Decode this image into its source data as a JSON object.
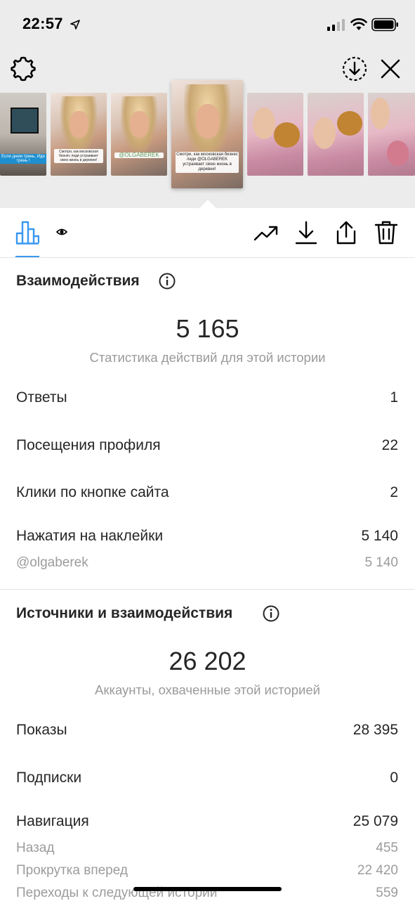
{
  "status_bar": {
    "time": "22:57"
  },
  "thumbnails": [
    {
      "kind": "tv",
      "caption": "Если днем трень, Иди трень !"
    },
    {
      "kind": "woman",
      "caption": "Смотри, как московская бизнес леди устраивает свою жизнь в деревне!"
    },
    {
      "kind": "woman",
      "caption": "@OLGABEREK"
    },
    {
      "kind": "woman-selected",
      "caption": "Смотри, как московская бизнес леди @OLGABEREK устраивает свою жизнь в деревне!"
    },
    {
      "kind": "kid",
      "caption": ""
    },
    {
      "kind": "kid",
      "caption": ""
    },
    {
      "kind": "kid",
      "caption": ""
    }
  ],
  "interactions": {
    "title": "Взаимодействия",
    "total": "5 165",
    "caption": "Статистика действий для этой истории",
    "rows": [
      {
        "label": "Ответы",
        "value": "1"
      },
      {
        "label": "Посещения профиля",
        "value": "22"
      },
      {
        "label": "Клики по кнопке сайта",
        "value": "2"
      },
      {
        "label": "Нажатия на наклейки",
        "value": "5 140"
      }
    ],
    "sub_rows": [
      {
        "label": "@olgaberek",
        "value": "5 140"
      }
    ]
  },
  "discovery": {
    "title": "Источники и взаимодействия",
    "total": "26 202",
    "caption": "Аккаунты, охваченные этой историей",
    "rows": [
      {
        "label": "Показы",
        "value": "28 395"
      },
      {
        "label": "Подписки",
        "value": "0"
      },
      {
        "label": "Навигация",
        "value": "25 079"
      }
    ],
    "sub_rows": [
      {
        "label": "Назад",
        "value": "455"
      },
      {
        "label": "Прокрутка вперед",
        "value": "22 420"
      },
      {
        "label": "Переходы к следующей истории",
        "value": "559"
      }
    ]
  },
  "colors": {
    "accent": "#3897f0",
    "muted_text": "#9a9a9a",
    "text": "#262626"
  }
}
